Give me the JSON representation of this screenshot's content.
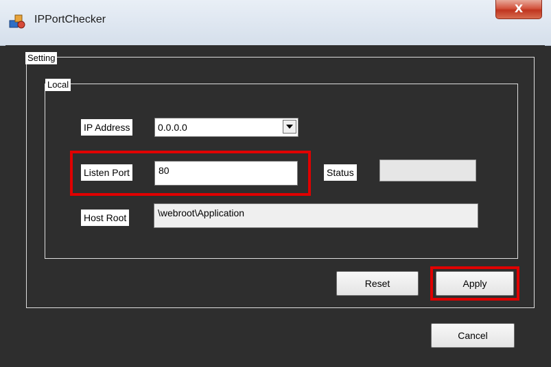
{
  "window": {
    "title": "IPPortChecker",
    "close_label": "X"
  },
  "setting_group": {
    "label": "Setting",
    "local_group": {
      "label": "Local",
      "ip_address": {
        "label": "IP Address",
        "value": "0.0.0.0"
      },
      "listen_port": {
        "label": "Listen Port",
        "value": "80"
      },
      "status": {
        "label": "Status",
        "value": ""
      },
      "host_root": {
        "label": "Host Root",
        "value": "\\webroot\\Application"
      }
    },
    "reset_label": "Reset",
    "apply_label": "Apply"
  },
  "cancel_label": "Cancel",
  "colors": {
    "background": "#2e2e2e",
    "highlight": "#e00000",
    "close_button": "#c0351f"
  }
}
